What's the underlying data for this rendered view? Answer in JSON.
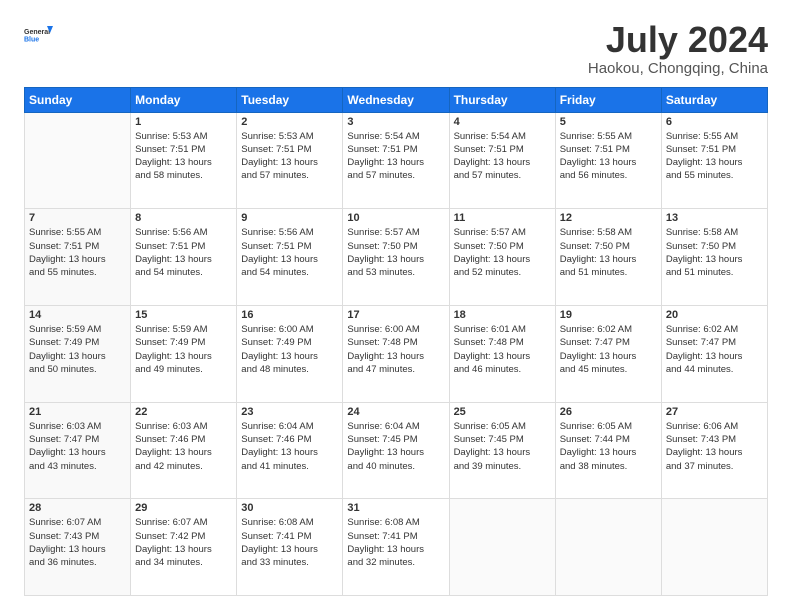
{
  "header": {
    "logo_line1": "General",
    "logo_line2": "Blue",
    "title": "July 2024",
    "subtitle": "Haokou, Chongqing, China"
  },
  "days_of_week": [
    "Sunday",
    "Monday",
    "Tuesday",
    "Wednesday",
    "Thursday",
    "Friday",
    "Saturday"
  ],
  "weeks": [
    [
      {
        "day": "",
        "info": ""
      },
      {
        "day": "1",
        "info": "Sunrise: 5:53 AM\nSunset: 7:51 PM\nDaylight: 13 hours\nand 58 minutes."
      },
      {
        "day": "2",
        "info": "Sunrise: 5:53 AM\nSunset: 7:51 PM\nDaylight: 13 hours\nand 57 minutes."
      },
      {
        "day": "3",
        "info": "Sunrise: 5:54 AM\nSunset: 7:51 PM\nDaylight: 13 hours\nand 57 minutes."
      },
      {
        "day": "4",
        "info": "Sunrise: 5:54 AM\nSunset: 7:51 PM\nDaylight: 13 hours\nand 57 minutes."
      },
      {
        "day": "5",
        "info": "Sunrise: 5:55 AM\nSunset: 7:51 PM\nDaylight: 13 hours\nand 56 minutes."
      },
      {
        "day": "6",
        "info": "Sunrise: 5:55 AM\nSunset: 7:51 PM\nDaylight: 13 hours\nand 55 minutes."
      }
    ],
    [
      {
        "day": "7",
        "info": "Sunrise: 5:55 AM\nSunset: 7:51 PM\nDaylight: 13 hours\nand 55 minutes."
      },
      {
        "day": "8",
        "info": "Sunrise: 5:56 AM\nSunset: 7:51 PM\nDaylight: 13 hours\nand 54 minutes."
      },
      {
        "day": "9",
        "info": "Sunrise: 5:56 AM\nSunset: 7:51 PM\nDaylight: 13 hours\nand 54 minutes."
      },
      {
        "day": "10",
        "info": "Sunrise: 5:57 AM\nSunset: 7:50 PM\nDaylight: 13 hours\nand 53 minutes."
      },
      {
        "day": "11",
        "info": "Sunrise: 5:57 AM\nSunset: 7:50 PM\nDaylight: 13 hours\nand 52 minutes."
      },
      {
        "day": "12",
        "info": "Sunrise: 5:58 AM\nSunset: 7:50 PM\nDaylight: 13 hours\nand 51 minutes."
      },
      {
        "day": "13",
        "info": "Sunrise: 5:58 AM\nSunset: 7:50 PM\nDaylight: 13 hours\nand 51 minutes."
      }
    ],
    [
      {
        "day": "14",
        "info": "Sunrise: 5:59 AM\nSunset: 7:49 PM\nDaylight: 13 hours\nand 50 minutes."
      },
      {
        "day": "15",
        "info": "Sunrise: 5:59 AM\nSunset: 7:49 PM\nDaylight: 13 hours\nand 49 minutes."
      },
      {
        "day": "16",
        "info": "Sunrise: 6:00 AM\nSunset: 7:49 PM\nDaylight: 13 hours\nand 48 minutes."
      },
      {
        "day": "17",
        "info": "Sunrise: 6:00 AM\nSunset: 7:48 PM\nDaylight: 13 hours\nand 47 minutes."
      },
      {
        "day": "18",
        "info": "Sunrise: 6:01 AM\nSunset: 7:48 PM\nDaylight: 13 hours\nand 46 minutes."
      },
      {
        "day": "19",
        "info": "Sunrise: 6:02 AM\nSunset: 7:47 PM\nDaylight: 13 hours\nand 45 minutes."
      },
      {
        "day": "20",
        "info": "Sunrise: 6:02 AM\nSunset: 7:47 PM\nDaylight: 13 hours\nand 44 minutes."
      }
    ],
    [
      {
        "day": "21",
        "info": "Sunrise: 6:03 AM\nSunset: 7:47 PM\nDaylight: 13 hours\nand 43 minutes."
      },
      {
        "day": "22",
        "info": "Sunrise: 6:03 AM\nSunset: 7:46 PM\nDaylight: 13 hours\nand 42 minutes."
      },
      {
        "day": "23",
        "info": "Sunrise: 6:04 AM\nSunset: 7:46 PM\nDaylight: 13 hours\nand 41 minutes."
      },
      {
        "day": "24",
        "info": "Sunrise: 6:04 AM\nSunset: 7:45 PM\nDaylight: 13 hours\nand 40 minutes."
      },
      {
        "day": "25",
        "info": "Sunrise: 6:05 AM\nSunset: 7:45 PM\nDaylight: 13 hours\nand 39 minutes."
      },
      {
        "day": "26",
        "info": "Sunrise: 6:05 AM\nSunset: 7:44 PM\nDaylight: 13 hours\nand 38 minutes."
      },
      {
        "day": "27",
        "info": "Sunrise: 6:06 AM\nSunset: 7:43 PM\nDaylight: 13 hours\nand 37 minutes."
      }
    ],
    [
      {
        "day": "28",
        "info": "Sunrise: 6:07 AM\nSunset: 7:43 PM\nDaylight: 13 hours\nand 36 minutes."
      },
      {
        "day": "29",
        "info": "Sunrise: 6:07 AM\nSunset: 7:42 PM\nDaylight: 13 hours\nand 34 minutes."
      },
      {
        "day": "30",
        "info": "Sunrise: 6:08 AM\nSunset: 7:41 PM\nDaylight: 13 hours\nand 33 minutes."
      },
      {
        "day": "31",
        "info": "Sunrise: 6:08 AM\nSunset: 7:41 PM\nDaylight: 13 hours\nand 32 minutes."
      },
      {
        "day": "",
        "info": ""
      },
      {
        "day": "",
        "info": ""
      },
      {
        "day": "",
        "info": ""
      }
    ]
  ]
}
